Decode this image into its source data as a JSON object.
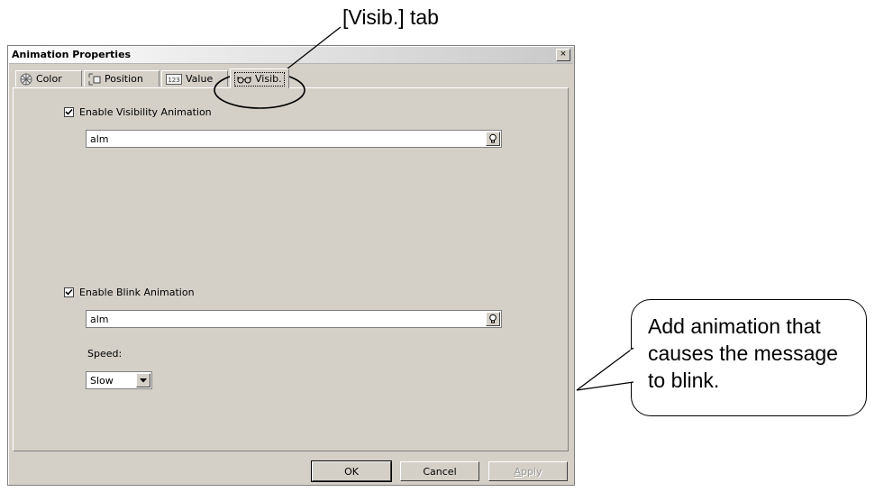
{
  "window": {
    "title": "Animation Properties",
    "close_glyph": "×"
  },
  "tabs": [
    {
      "label": "Color",
      "icon": "color-wheel-icon"
    },
    {
      "label": "Position",
      "icon": "position-icon"
    },
    {
      "label": "Value",
      "icon": "value-123-icon",
      "icon_text": "123"
    },
    {
      "label": "Visib.",
      "icon": "glasses-icon",
      "active": true
    }
  ],
  "visibility": {
    "checkbox_label": "Enable Visibility Animation",
    "checked": true,
    "expression": "alm"
  },
  "blink": {
    "checkbox_label": "Enable Blink Animation",
    "checked": true,
    "expression": "alm",
    "speed_label": "Speed:",
    "speed_value": "Slow"
  },
  "buttons": {
    "ok": "OK",
    "cancel": "Cancel",
    "apply": "Apply"
  },
  "annotations": {
    "tab_callout": "[Visib.] tab",
    "blink_callout": [
      "Add animation that",
      "causes the message",
      "to blink."
    ]
  }
}
